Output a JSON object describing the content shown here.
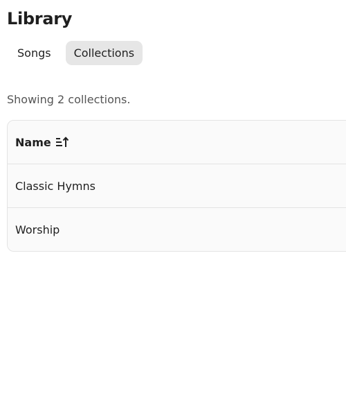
{
  "page": {
    "title": "Library"
  },
  "tabs": [
    {
      "label": "Songs",
      "active": false
    },
    {
      "label": "Collections",
      "active": true
    }
  ],
  "summary": "Showing 2 collections.",
  "table": {
    "columns": [
      {
        "label": "Name",
        "sort": "ascending",
        "sort_icon": "sort-ascending-icon"
      }
    ],
    "rows": [
      {
        "name": "Classic Hymns"
      },
      {
        "name": "Worship"
      }
    ]
  },
  "colors": {
    "active_tab_bg": "#e6e6e6",
    "table_bg": "#fafafa",
    "border": "#e3e3e3",
    "muted_text": "#555555"
  }
}
